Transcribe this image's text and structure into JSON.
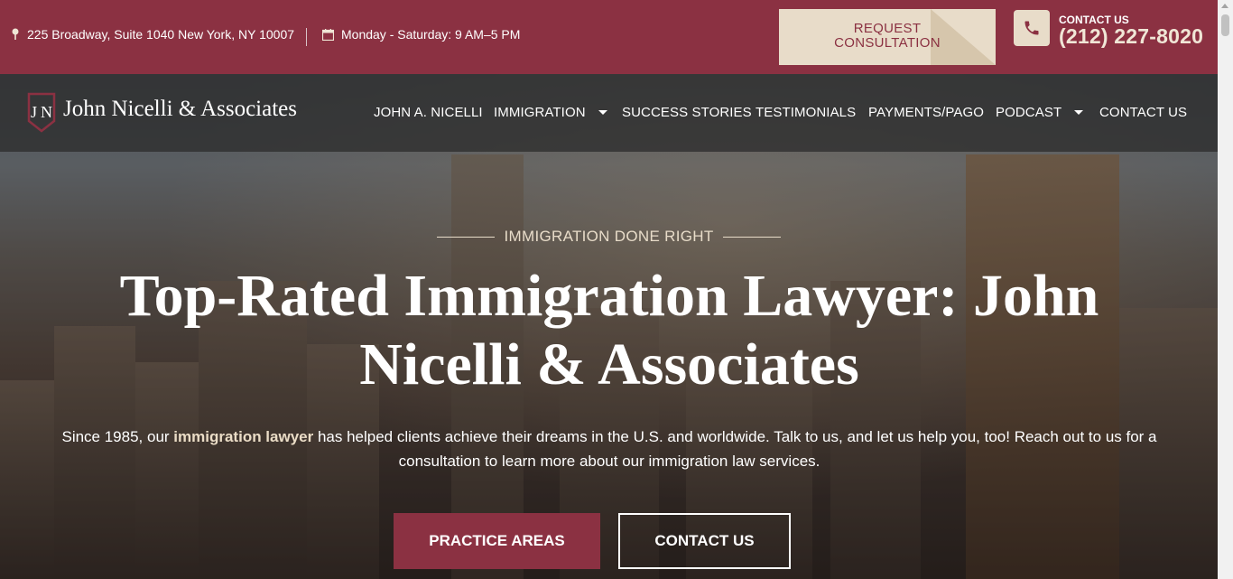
{
  "topbar": {
    "address": "225 Broadway, Suite 1040 New York, NY 10007",
    "hours": "Monday - Saturday: 9 AM–5 PM",
    "request_line1": "REQUEST",
    "request_line2": "CONSULTATION",
    "contact_label": "CONTACT US",
    "phone": "(212) 227-8020"
  },
  "brand": {
    "name": "John Nicelli & Associates"
  },
  "nav": {
    "items": [
      {
        "label": "JOHN A. NICELLI",
        "dropdown": false
      },
      {
        "label": "IMMIGRATION",
        "dropdown": true
      },
      {
        "label": "SUCCESS STORIES",
        "dropdown": false
      },
      {
        "label": "TESTIMONIALS",
        "dropdown": false
      },
      {
        "label": "PAYMENTS/PAGO",
        "dropdown": false
      },
      {
        "label": "PODCAST",
        "dropdown": true
      },
      {
        "label": "CONTACT US",
        "dropdown": false
      }
    ]
  },
  "hero": {
    "eyebrow": "IMMIGRATION DONE RIGHT",
    "title": "Top-Rated Immigration Lawyer: John Nicelli & Associates",
    "subtitle_pre": "Since 1985, our ",
    "subtitle_bold": "immigration lawyer",
    "subtitle_post": " has helped clients achieve their dreams in the U.S. and worldwide. Talk to us, and let us help you, too! Reach out to us for a consultation to learn more about our immigration law services.",
    "btn_practice": "PRACTICE AREAS",
    "btn_contact": "CONTACT US"
  },
  "colors": {
    "brand": "#8b3142",
    "accent": "#e8dcc9"
  }
}
